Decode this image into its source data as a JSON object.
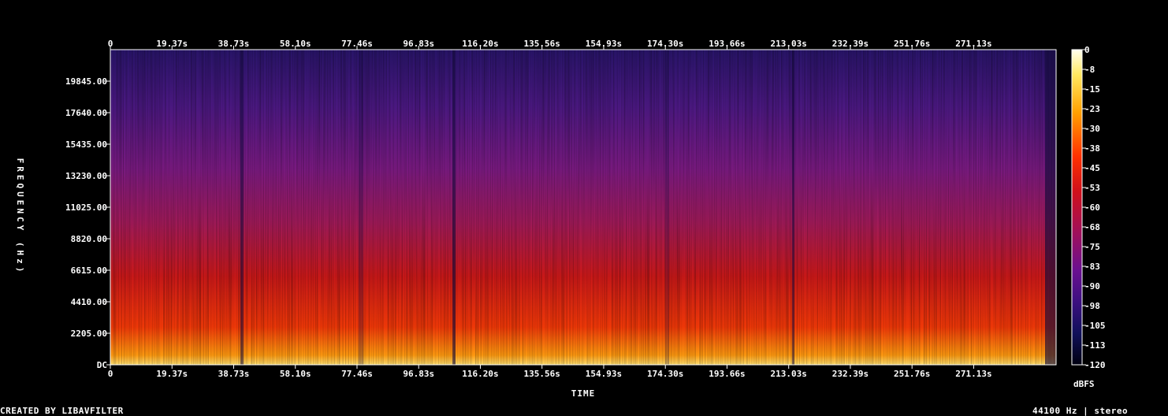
{
  "chart_data": {
    "type": "heatmap",
    "title": "",
    "xlabel": "TIME",
    "ylabel": "FREQUENCY (Hz)",
    "x_ticks": [
      "0",
      "19.37s",
      "38.73s",
      "58.10s",
      "77.46s",
      "96.83s",
      "116.20s",
      "135.56s",
      "154.93s",
      "174.30s",
      "193.66s",
      "213.03s",
      "232.39s",
      "251.76s",
      "271.13s"
    ],
    "y_ticks": [
      "DC",
      "2205.00",
      "4410.00",
      "6615.00",
      "8820.00",
      "11025.00",
      "13230.00",
      "15435.00",
      "17640.00",
      "19845.00"
    ],
    "xlim": [
      0,
      297
    ],
    "ylim": [
      0,
      22050
    ],
    "colorbar": {
      "label": "dBFS",
      "ticks": [
        "0",
        "-8",
        "-15",
        "-23",
        "-30",
        "-38",
        "-45",
        "-53",
        "-60",
        "-68",
        "-75",
        "-83",
        "-90",
        "-98",
        "-105",
        "-113",
        "-120"
      ],
      "range": [
        -120,
        0
      ]
    }
  },
  "footer": {
    "left": "CREATED BY LIBAVFILTER",
    "right": "44100 Hz | stereo"
  }
}
